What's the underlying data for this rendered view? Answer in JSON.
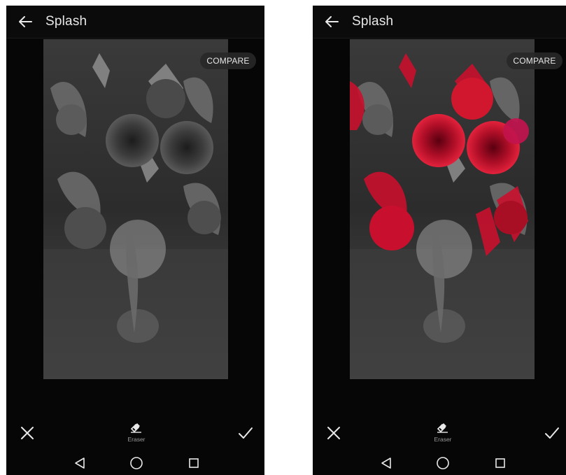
{
  "screens": [
    {
      "id": "left",
      "title": "Splash",
      "compare_label": "COMPARE",
      "tool_label": "Eraser",
      "icons": [
        "back-arrow-icon",
        "close-icon",
        "eraser-icon",
        "check-icon",
        "nav-back-icon",
        "nav-home-icon",
        "nav-recent-icon"
      ],
      "flowers_colored": false,
      "brush_visible": false
    },
    {
      "id": "right",
      "title": "Splash",
      "compare_label": "COMPARE",
      "tool_label": "Eraser",
      "icons": [
        "back-arrow-icon",
        "close-icon",
        "eraser-icon",
        "check-icon",
        "nav-back-icon",
        "nav-home-icon",
        "nav-recent-icon"
      ],
      "flowers_colored": true,
      "brush_visible": true
    }
  ],
  "colors": {
    "background": "#060606",
    "flower_red": "#c8102e",
    "brush": "#c1134d",
    "text": "#e8e8e8"
  }
}
